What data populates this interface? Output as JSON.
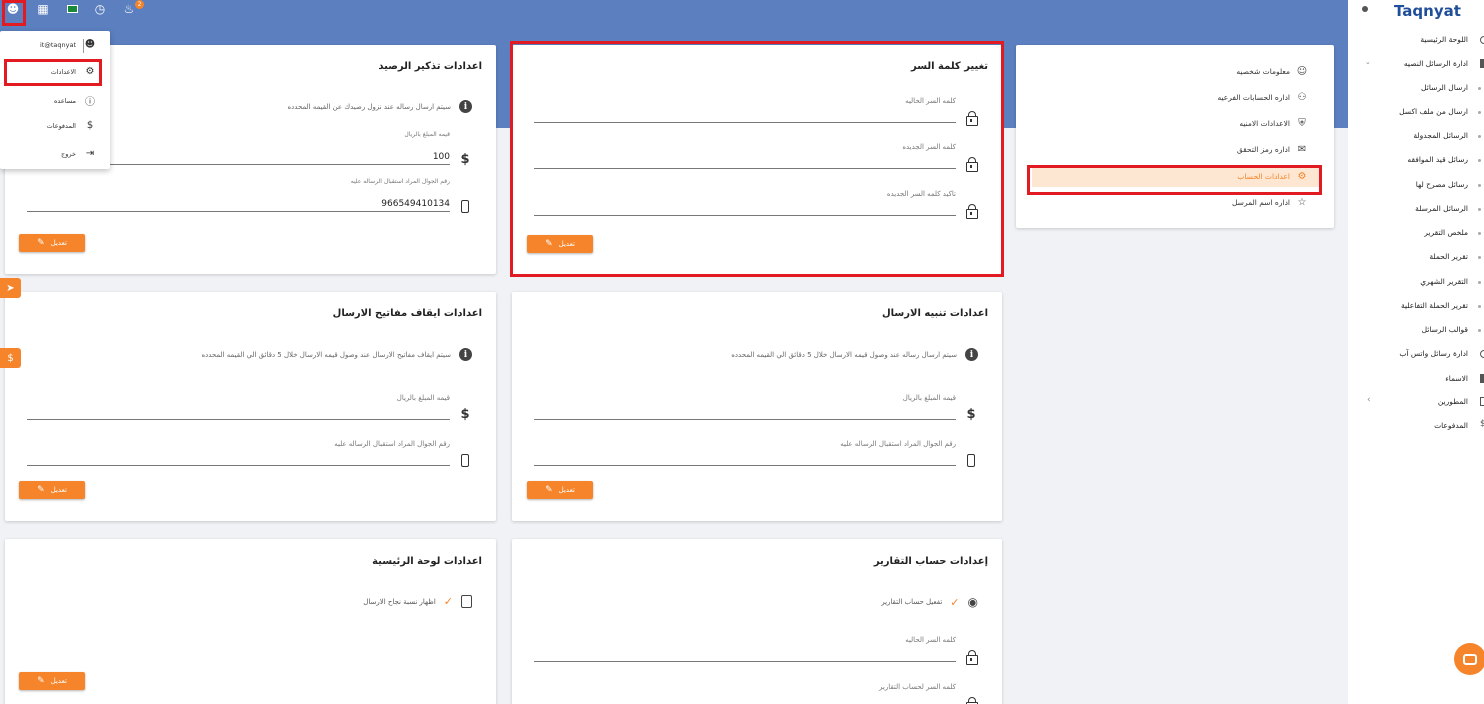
{
  "app": {
    "brand": "Taqnyat"
  },
  "topbar": {
    "notification_count": "2"
  },
  "user_menu": {
    "username": "it@taqnyat",
    "items": [
      {
        "label": "الاعدادات",
        "icon": "gear-icon"
      },
      {
        "label": "مساعده",
        "icon": "help-circle-icon"
      },
      {
        "label": "المدفوعات",
        "icon": "dollar-icon"
      },
      {
        "label": "خروج",
        "icon": "logout-icon"
      }
    ]
  },
  "sidebar": {
    "items": [
      {
        "label": "اللوحة الرئيسية"
      },
      {
        "label": "ادارة الرسائل النصيه"
      },
      {
        "label": "ارسال الرسائل"
      },
      {
        "label": "ارسال من ملف اكسل"
      },
      {
        "label": "الرسائل المجدولة"
      },
      {
        "label": "رسائل قيد الموافقه"
      },
      {
        "label": "رسائل مصرح لها"
      },
      {
        "label": "الرسائل المرسلة"
      },
      {
        "label": "ملخص التقرير"
      },
      {
        "label": "تقرير الحملة"
      },
      {
        "label": "التقرير الشهري"
      },
      {
        "label": "تقرير الحملة التفاعلية"
      },
      {
        "label": "قوالب الرسائل"
      },
      {
        "label": "ادارة رسائل واتس آب"
      },
      {
        "label": "الاسماء"
      },
      {
        "label": "المطورين"
      },
      {
        "label": "المدفوعات"
      }
    ]
  },
  "account_menu": {
    "items": [
      {
        "label": "معلومات شخصيه",
        "icon": "face-icon"
      },
      {
        "label": "اداره الحسابات الفرعيه",
        "icon": "users-icon"
      },
      {
        "label": "الاعدادات الامنيه",
        "icon": "shield-icon"
      },
      {
        "label": "اداره رمز التحقق",
        "icon": "sms-icon"
      },
      {
        "label": "اعدادات الحساب",
        "icon": "gear-icon"
      },
      {
        "label": "اداره اسم المرسل",
        "icon": "star-icon"
      }
    ]
  },
  "balance_reminder": {
    "title": "اعدادات تذكير الرصيد",
    "info": "سيتم ارسال رساله عند نزول رصيدك عن القيمه المحدده",
    "amount_label": "قيمه المبلغ بالريال",
    "amount_value": "100",
    "mobile_label": "رقم الجوال المراد استقبال الرساله عليه",
    "mobile_value": "966549410134",
    "edit_label": "تعديل"
  },
  "change_password": {
    "title": "تغيير كلمة السر",
    "current": "كلمه السر الحاليه",
    "new": "كلمه السر الجديده",
    "confirm": "تاكيد كلمه السر الجديده",
    "edit_label": "تعديل"
  },
  "stop_keys": {
    "title": "اعدادات ايقاف مفاتيح الارسال",
    "info": "سيتم ايقاف مفاتيح الارسال عند وصول قيمه الارسال خلال 5 دقائق الي القيمه المحدده",
    "amount_label": "قيمه المبلغ بالريال",
    "mobile_label": "رقم الجوال المراد استقبال الرساله عليه",
    "edit_label": "تعديل"
  },
  "send_alert": {
    "title": "اعدادات تنبيه الارسال",
    "info": "سيتم ارسال رساله عند وصول قيمه الارسال خلال 5 دقائق الي القيمه المحدده",
    "amount_label": "قيمه المبلغ بالريال",
    "mobile_label": "رقم الجوال المراد استقبال الرساله عليه",
    "edit_label": "تعديل"
  },
  "dashboard_settings": {
    "title": "اعدادات لوحة الرئيسية",
    "option": "اظهار نسبة نجاح الارسال",
    "edit_label": "تعديل"
  },
  "reports_account": {
    "title": "إعدادات حساب التقارير",
    "option": "تفعيل حساب التقارير",
    "current": "كلمه السر الحاليه",
    "report_pw": "كلمه السر لحساب التقارير"
  },
  "colors": {
    "accent": "#f5842a",
    "header": "#5b7fbf",
    "highlight": "#e21b23",
    "brand": "#1f4e9a"
  }
}
